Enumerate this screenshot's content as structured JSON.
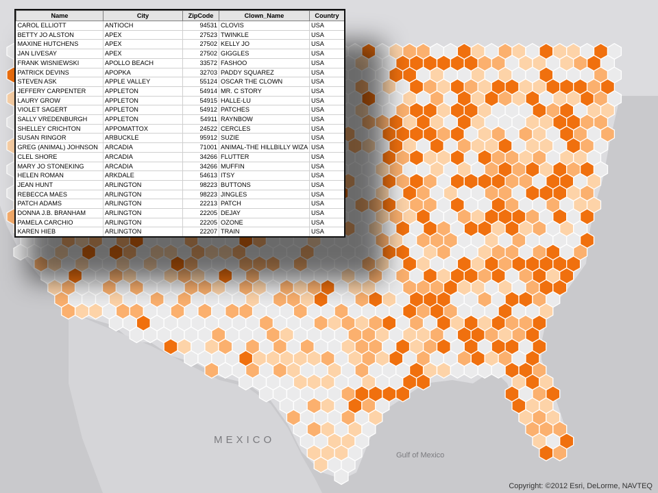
{
  "table": {
    "columns": [
      "Name",
      "City",
      "ZipCode",
      "Clown_Name",
      "Country"
    ],
    "rows": [
      [
        "CAROL ELLIOTT",
        "ANTIOCH",
        "94531",
        "CLOVIS",
        "USA"
      ],
      [
        "BETTY JO ALSTON",
        "APEX",
        "27523",
        "TWINKLE",
        "USA"
      ],
      [
        "MAXINE HUTCHENS",
        "APEX",
        "27502",
        "KELLY JO",
        "USA"
      ],
      [
        "JAN LIVESAY",
        "APEX",
        "27502",
        "GIGGLES",
        "USA"
      ],
      [
        "FRANK WISNIEWSKI",
        "APOLLO BEACH",
        "33572",
        "FASHOO",
        "USA"
      ],
      [
        "PATRICK DEVINS",
        "APOPKA",
        "32703",
        "PADDY SQUAREZ",
        "USA"
      ],
      [
        "STEVEN ASK",
        "APPLE VALLEY",
        "55124",
        "OSCAR THE CLOWN",
        "USA"
      ],
      [
        "JEFFERY CARPENTER",
        "APPLETON",
        "54914",
        "MR. C STORY",
        "USA"
      ],
      [
        "LAURY GROW",
        "APPLETON",
        "54915",
        "HALLE-LU",
        "USA"
      ],
      [
        "VIOLET SAGERT",
        "APPLETON",
        "54912",
        "PATCHES",
        "USA"
      ],
      [
        "SALLY VREDENBURGH",
        "APPLETON",
        "54911",
        "RAYNBOW",
        "USA"
      ],
      [
        "SHELLEY CRICHTON",
        "APPOMATTOX",
        "24522",
        "CERCLES",
        "USA"
      ],
      [
        "SUSAN RINGOR",
        "ARBUCKLE",
        "95912",
        "SUZIE",
        "USA"
      ],
      [
        "GREG (ANIMAL) JOHNSON",
        "ARCADIA",
        "71001",
        "ANIMAL-THE HILLBILLY WIZA",
        "USA"
      ],
      [
        "CLEL SHORE",
        "ARCADIA",
        "34266",
        "FLUTTER",
        "USA"
      ],
      [
        "MARY JO STONEKING",
        "ARCADIA",
        "34266",
        "MUFFIN",
        "USA"
      ],
      [
        "HELEN ROMAN",
        "ARKDALE",
        "54613",
        "ITSY",
        "USA"
      ],
      [
        "JEAN HUNT",
        "ARLINGTON",
        "98223",
        "BUTTONS",
        "USA"
      ],
      [
        "REBECCA MAES",
        "ARLINGTON",
        "98223",
        "JINGLES",
        "USA"
      ],
      [
        "PATCH ADAMS",
        "ARLINGTON",
        "22213",
        "PATCH",
        "USA"
      ],
      [
        "DONNA J.B. BRANHAM",
        "ARLINGTON",
        "22205",
        "DEJAY",
        "USA"
      ],
      [
        "PAMELA CARCHIO",
        "ARLINGTON",
        "22205",
        "OZONE",
        "USA"
      ],
      [
        "KAREN HIEB",
        "ARLINGTON",
        "22207",
        "TRAIN",
        "USA"
      ]
    ]
  },
  "map": {
    "labels": {
      "mexico": "MEXICO",
      "gulf": "Gulf of Mexico"
    },
    "copyright": "Copyright: ©2012 Esri, DeLorme, NAVTEQ",
    "colors": {
      "land": "#dcdcdf",
      "water": "#c9c9cc",
      "empty_hex": "#ebebec",
      "class_1": "#fdd3a8",
      "class_2": "#fbb06e",
      "class_3": "#f0700e",
      "hex_stroke": "#ffffff"
    }
  }
}
